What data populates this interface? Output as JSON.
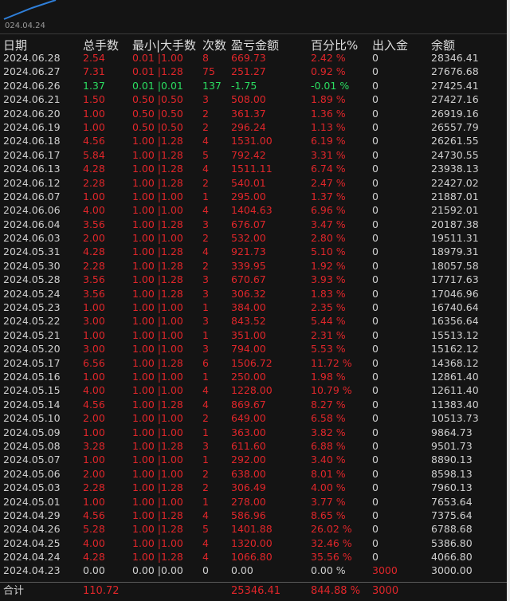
{
  "chart": {
    "axis_label": "024.04.24",
    "line_color": "#2f7fd9"
  },
  "headers": {
    "date": "日期",
    "lots": "总手数",
    "minmax": "最小|大手数",
    "count": "次数",
    "pnl": "盈亏金额",
    "pct": "百分比%",
    "flow": "出入金",
    "balance": "余额"
  },
  "colors": {
    "loss_or_profit_text": "#e0262a",
    "negative_day_text": "#2bde61",
    "neutral_text": "#cfcfcf",
    "background": "#141414"
  },
  "rows": [
    {
      "date": "2024.06.28",
      "lots": "2.54",
      "minmax": "0.01 |1.00",
      "count": "8",
      "pnl": "669.73",
      "pct": "2.42 %",
      "flow": "0",
      "balance": "28346.41",
      "tone": "red"
    },
    {
      "date": "2024.06.27",
      "lots": "7.31",
      "minmax": "0.01 |1.28",
      "count": "75",
      "pnl": "251.27",
      "pct": "0.92 %",
      "flow": "0",
      "balance": "27676.68",
      "tone": "red"
    },
    {
      "date": "2024.06.26",
      "lots": "1.37",
      "minmax": "0.01 |0.01",
      "count": "137",
      "pnl": "-1.75",
      "pct": "-0.01 %",
      "flow": "0",
      "balance": "27425.41",
      "tone": "green"
    },
    {
      "date": "2024.06.21",
      "lots": "1.50",
      "minmax": "0.50 |0.50",
      "count": "3",
      "pnl": "508.00",
      "pct": "1.89 %",
      "flow": "0",
      "balance": "27427.16",
      "tone": "red"
    },
    {
      "date": "2024.06.20",
      "lots": "1.00",
      "minmax": "0.50 |0.50",
      "count": "2",
      "pnl": "361.37",
      "pct": "1.36 %",
      "flow": "0",
      "balance": "26919.16",
      "tone": "red"
    },
    {
      "date": "2024.06.19",
      "lots": "1.00",
      "minmax": "0.50 |0.50",
      "count": "2",
      "pnl": "296.24",
      "pct": "1.13 %",
      "flow": "0",
      "balance": "26557.79",
      "tone": "red"
    },
    {
      "date": "2024.06.18",
      "lots": "4.56",
      "minmax": "1.00 |1.28",
      "count": "4",
      "pnl": "1531.00",
      "pct": "6.19 %",
      "flow": "0",
      "balance": "26261.55",
      "tone": "red"
    },
    {
      "date": "2024.06.17",
      "lots": "5.84",
      "minmax": "1.00 |1.28",
      "count": "5",
      "pnl": "792.42",
      "pct": "3.31 %",
      "flow": "0",
      "balance": "24730.55",
      "tone": "red"
    },
    {
      "date": "2024.06.13",
      "lots": "4.28",
      "minmax": "1.00 |1.28",
      "count": "4",
      "pnl": "1511.11",
      "pct": "6.74 %",
      "flow": "0",
      "balance": "23938.13",
      "tone": "red"
    },
    {
      "date": "2024.06.12",
      "lots": "2.28",
      "minmax": "1.00 |1.28",
      "count": "2",
      "pnl": "540.01",
      "pct": "2.47 %",
      "flow": "0",
      "balance": "22427.02",
      "tone": "red"
    },
    {
      "date": "2024.06.07",
      "lots": "1.00",
      "minmax": "1.00 |1.00",
      "count": "1",
      "pnl": "295.00",
      "pct": "1.37 %",
      "flow": "0",
      "balance": "21887.01",
      "tone": "red"
    },
    {
      "date": "2024.06.06",
      "lots": "4.00",
      "minmax": "1.00 |1.00",
      "count": "4",
      "pnl": "1404.63",
      "pct": "6.96 %",
      "flow": "0",
      "balance": "21592.01",
      "tone": "red"
    },
    {
      "date": "2024.06.04",
      "lots": "3.56",
      "minmax": "1.00 |1.28",
      "count": "3",
      "pnl": "676.07",
      "pct": "3.47 %",
      "flow": "0",
      "balance": "20187.38",
      "tone": "red"
    },
    {
      "date": "2024.06.03",
      "lots": "2.00",
      "minmax": "1.00 |1.00",
      "count": "2",
      "pnl": "532.00",
      "pct": "2.80 %",
      "flow": "0",
      "balance": "19511.31",
      "tone": "red"
    },
    {
      "date": "2024.05.31",
      "lots": "4.28",
      "minmax": "1.00 |1.28",
      "count": "4",
      "pnl": "921.73",
      "pct": "5.10 %",
      "flow": "0",
      "balance": "18979.31",
      "tone": "red"
    },
    {
      "date": "2024.05.30",
      "lots": "2.28",
      "minmax": "1.00 |1.28",
      "count": "2",
      "pnl": "339.95",
      "pct": "1.92 %",
      "flow": "0",
      "balance": "18057.58",
      "tone": "red"
    },
    {
      "date": "2024.05.28",
      "lots": "3.56",
      "minmax": "1.00 |1.28",
      "count": "3",
      "pnl": "670.67",
      "pct": "3.93 %",
      "flow": "0",
      "balance": "17717.63",
      "tone": "red"
    },
    {
      "date": "2024.05.24",
      "lots": "3.56",
      "minmax": "1.00 |1.28",
      "count": "3",
      "pnl": "306.32",
      "pct": "1.83 %",
      "flow": "0",
      "balance": "17046.96",
      "tone": "red"
    },
    {
      "date": "2024.05.23",
      "lots": "1.00",
      "minmax": "1.00 |1.00",
      "count": "1",
      "pnl": "384.00",
      "pct": "2.35 %",
      "flow": "0",
      "balance": "16740.64",
      "tone": "red"
    },
    {
      "date": "2024.05.22",
      "lots": "3.00",
      "minmax": "1.00 |1.00",
      "count": "3",
      "pnl": "843.52",
      "pct": "5.44 %",
      "flow": "0",
      "balance": "16356.64",
      "tone": "red"
    },
    {
      "date": "2024.05.21",
      "lots": "1.00",
      "minmax": "1.00 |1.00",
      "count": "1",
      "pnl": "351.00",
      "pct": "2.31 %",
      "flow": "0",
      "balance": "15513.12",
      "tone": "red"
    },
    {
      "date": "2024.05.20",
      "lots": "3.00",
      "minmax": "1.00 |1.00",
      "count": "3",
      "pnl": "794.00",
      "pct": "5.53 %",
      "flow": "0",
      "balance": "15162.12",
      "tone": "red"
    },
    {
      "date": "2024.05.17",
      "lots": "6.56",
      "minmax": "1.00 |1.28",
      "count": "6",
      "pnl": "1506.72",
      "pct": "11.72 %",
      "flow": "0",
      "balance": "14368.12",
      "tone": "red"
    },
    {
      "date": "2024.05.16",
      "lots": "1.00",
      "minmax": "1.00 |1.00",
      "count": "1",
      "pnl": "250.00",
      "pct": "1.98 %",
      "flow": "0",
      "balance": "12861.40",
      "tone": "red"
    },
    {
      "date": "2024.05.15",
      "lots": "4.00",
      "minmax": "1.00 |1.00",
      "count": "4",
      "pnl": "1228.00",
      "pct": "10.79 %",
      "flow": "0",
      "balance": "12611.40",
      "tone": "red"
    },
    {
      "date": "2024.05.14",
      "lots": "4.56",
      "minmax": "1.00 |1.28",
      "count": "4",
      "pnl": "869.67",
      "pct": "8.27 %",
      "flow": "0",
      "balance": "11383.40",
      "tone": "red"
    },
    {
      "date": "2024.05.10",
      "lots": "2.00",
      "minmax": "1.00 |1.00",
      "count": "2",
      "pnl": "649.00",
      "pct": "6.58 %",
      "flow": "0",
      "balance": "10513.73",
      "tone": "red"
    },
    {
      "date": "2024.05.09",
      "lots": "1.00",
      "minmax": "1.00 |1.00",
      "count": "1",
      "pnl": "363.00",
      "pct": "3.82 %",
      "flow": "0",
      "balance": "9864.73",
      "tone": "red"
    },
    {
      "date": "2024.05.08",
      "lots": "3.28",
      "minmax": "1.00 |1.28",
      "count": "3",
      "pnl": "611.60",
      "pct": "6.88 %",
      "flow": "0",
      "balance": "9501.73",
      "tone": "red"
    },
    {
      "date": "2024.05.07",
      "lots": "1.00",
      "minmax": "1.00 |1.00",
      "count": "1",
      "pnl": "292.00",
      "pct": "3.40 %",
      "flow": "0",
      "balance": "8890.13",
      "tone": "red"
    },
    {
      "date": "2024.05.06",
      "lots": "2.00",
      "minmax": "1.00 |1.00",
      "count": "2",
      "pnl": "638.00",
      "pct": "8.01 %",
      "flow": "0",
      "balance": "8598.13",
      "tone": "red"
    },
    {
      "date": "2024.05.03",
      "lots": "2.28",
      "minmax": "1.00 |1.28",
      "count": "2",
      "pnl": "306.49",
      "pct": "4.00 %",
      "flow": "0",
      "balance": "7960.13",
      "tone": "red"
    },
    {
      "date": "2024.05.01",
      "lots": "1.00",
      "minmax": "1.00 |1.00",
      "count": "1",
      "pnl": "278.00",
      "pct": "3.77 %",
      "flow": "0",
      "balance": "7653.64",
      "tone": "red"
    },
    {
      "date": "2024.04.29",
      "lots": "4.56",
      "minmax": "1.00 |1.28",
      "count": "4",
      "pnl": "586.96",
      "pct": "8.65 %",
      "flow": "0",
      "balance": "7375.64",
      "tone": "red"
    },
    {
      "date": "2024.04.26",
      "lots": "5.28",
      "minmax": "1.00 |1.28",
      "count": "5",
      "pnl": "1401.88",
      "pct": "26.02 %",
      "flow": "0",
      "balance": "6788.68",
      "tone": "red"
    },
    {
      "date": "2024.04.25",
      "lots": "4.00",
      "minmax": "1.00 |1.00",
      "count": "4",
      "pnl": "1320.00",
      "pct": "32.46 %",
      "flow": "0",
      "balance": "5386.80",
      "tone": "red"
    },
    {
      "date": "2024.04.24",
      "lots": "4.28",
      "minmax": "1.00 |1.28",
      "count": "4",
      "pnl": "1066.80",
      "pct": "35.56 %",
      "flow": "0",
      "balance": "4066.80",
      "tone": "red"
    },
    {
      "date": "2024.04.23",
      "lots": "0.00",
      "minmax": "0.00 |0.00",
      "count": "0",
      "pnl": "0.00",
      "pct": "0.00 %",
      "flow": "3000",
      "balance": "3000.00",
      "tone": "white",
      "flow_tone": "red"
    }
  ],
  "total": {
    "label": "合计",
    "lots": "110.72",
    "pnl": "25346.41",
    "pct": "844.88 %",
    "flow": "3000"
  }
}
